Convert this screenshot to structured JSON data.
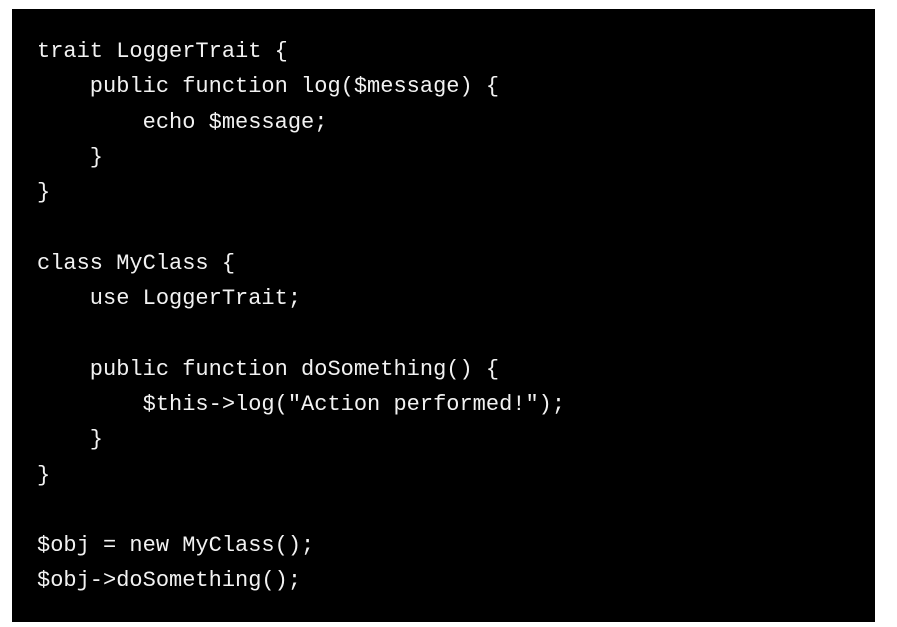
{
  "code": {
    "language": "php",
    "background": "#000000",
    "text_color": "#f2f2f2",
    "lines": [
      "trait LoggerTrait {",
      "    public function log($message) {",
      "        echo $message;",
      "    }",
      "}",
      "",
      "class MyClass {",
      "    use LoggerTrait;",
      "",
      "    public function doSomething() {",
      "        $this->log(\"Action performed!\");",
      "    }",
      "}",
      "",
      "$obj = new MyClass();",
      "$obj->doSomething();"
    ]
  }
}
